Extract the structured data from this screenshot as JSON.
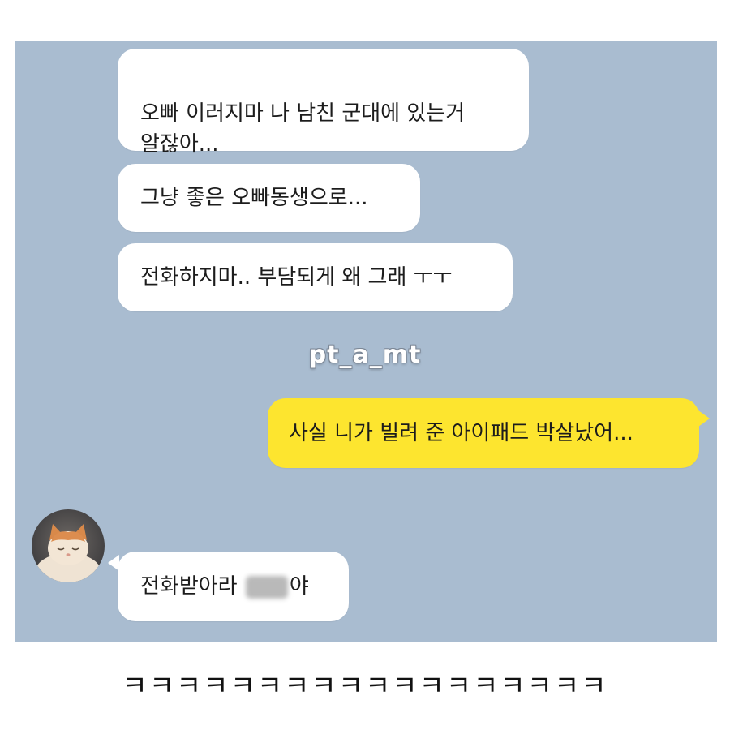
{
  "watermark": "pt_a_mt",
  "messages": [
    {
      "side": "received",
      "text": "오빠 이러지마 나 남친 군대에 있는거\n알잖아..."
    },
    {
      "side": "received",
      "text": "그냥 좋은 오빠동생으로..."
    },
    {
      "side": "received",
      "text": "전화하지마.. 부담되게 왜 그래 ㅜㅜ"
    },
    {
      "side": "sent",
      "text": "사실 니가 빌려 준 아이패드 박살났어..."
    },
    {
      "side": "received",
      "text_before": "전화받아라",
      "text_after": "야"
    }
  ],
  "avatar": {
    "icon": "cat-avatar-icon"
  },
  "caption": "ㅋㅋㅋㅋㅋㅋㅋㅋㅋㅋㅋㅋㅋㅋㅋㅋㅋㅋ",
  "colors": {
    "chat_bg": "#a9bcd0",
    "sent_bubble": "#fde52f",
    "received_bubble": "#ffffff"
  }
}
